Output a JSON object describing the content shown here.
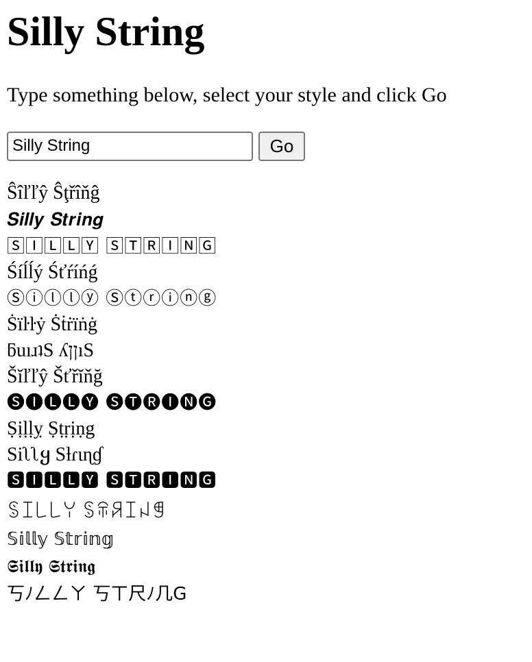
{
  "header": {
    "title": "Silly String"
  },
  "instructions": "Type something below, select your style and click Go",
  "form": {
    "input_value": "Silly String",
    "go_label": "Go"
  },
  "results": [
    "Ŝîľľŷ Ŝţřîňĝ",
    "𝑺𝒊𝒍𝒍𝒚 𝑺𝒕𝒓𝒊𝒏𝒈",
    "🅂🄸🄻🄻🅈 🅂🅃🅁🄸🄽🄶",
    "Śíĺĺý Śťŕíńǵ",
    "Ⓢⓘⓛⓛⓨ Ⓢⓣⓡⓘⓝⓖ",
    "Ṡïŀŀẏ Ṡṫṙïṅġ",
    "ƃuıɹʇS ʎןןıS",
    "Šĭľľŷ Šťřĭňğ",
    "🅢🅘🅛🅛🅨 🅢🅣🅡🅘🅝🅖",
    "Ṣịḷḷỵ Ṣṭṛịṇg",
    "Siʅʅყ Sƚɾιɳɠ",
    "🆂🅸🅻🅻🆈 🆂🆃🆁🅸🅽🅶",
    "ꌗꀤ꒒꒒ꌩ ꌗꋖꋪꀤꈤꁅ",
    "𝕊𝕚𝕝𝕝𝕪 𝕊𝕥𝕣𝕚𝕟𝕘",
    "𝕾𝖎𝖑𝖑𝖞 𝕾𝖙𝖗𝖎𝖓𝖌",
    "丂ﾉㄥㄥㄚ 丂ㄒ尺ﾉ几G"
  ]
}
